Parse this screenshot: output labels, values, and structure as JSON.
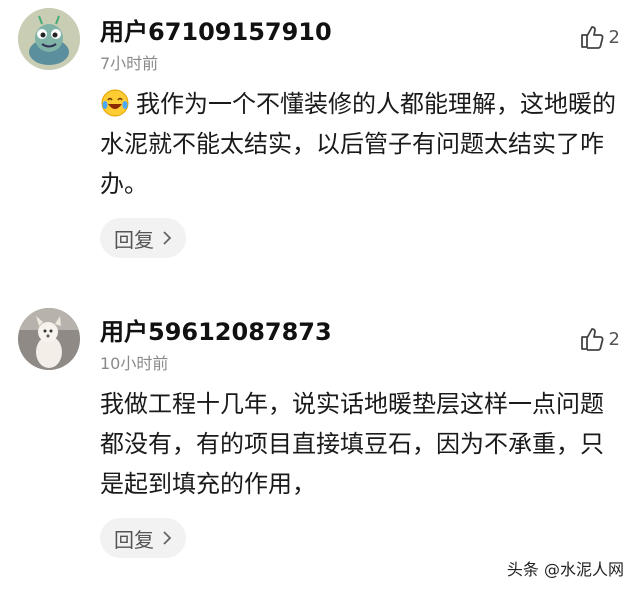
{
  "comments": [
    {
      "username": "用户67109157910",
      "time": "7小时前",
      "likes": "2",
      "avatar_icon": "green-snail-cartoon-avatar",
      "emoji_icon": "laughing-tears-emoji",
      "text": "我作为一个不懂装修的人都能理解，这地暖的水泥就不能太结实，以后管子有问题太结实了咋办。",
      "reply_label": "回复"
    },
    {
      "username": "用户59612087873",
      "time": "10小时前",
      "likes": "2",
      "avatar_icon": "white-dog-photo-avatar",
      "text": "我做工程十几年，说实话地暖垫层这样一点问题都没有，有的项目直接填豆石，因为不承重，只是起到填充的作用，",
      "reply_label": "回复"
    }
  ],
  "watermark": "头条 @水泥人网"
}
